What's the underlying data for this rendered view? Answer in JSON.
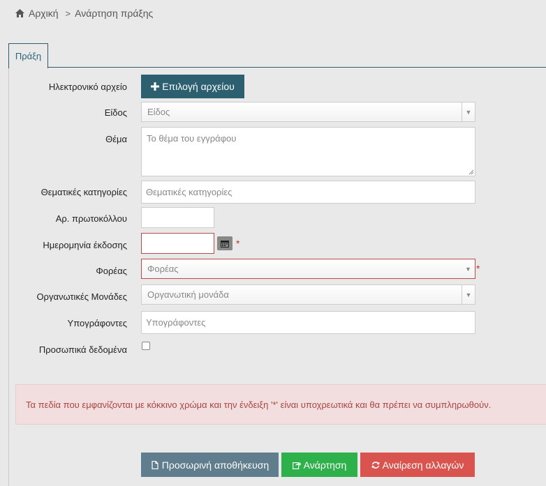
{
  "breadcrumb": {
    "home_icon": "home-icon",
    "home": "Αρχική",
    "separator": ">",
    "current": "Ανάρτηση πράξης"
  },
  "tab": {
    "label": "Πράξη"
  },
  "form": {
    "electronic_file": {
      "label": "Ηλεκτρονικό αρχείο",
      "button": "Επιλογή αρχείου",
      "icon": "plus-icon"
    },
    "type": {
      "label": "Είδος",
      "placeholder": "Είδος"
    },
    "subject": {
      "label": "Θέμα",
      "placeholder": "Το θέμα του εγγράφου"
    },
    "thematic_categories": {
      "label": "Θεματικές κατηγορίες",
      "placeholder": "Θεματικές κατηγορίες"
    },
    "protocol_number": {
      "label": "Αρ. πρωτοκόλλου",
      "value": ""
    },
    "issue_date": {
      "label": "Ημερομηνία έκδοσης",
      "value": "",
      "icon": "calendar-icon"
    },
    "organization": {
      "label": "Φορέας",
      "placeholder": "Φορέας"
    },
    "org_units": {
      "label": "Οργανωτικές Μονάδες",
      "placeholder": "Οργανωτική μονάδα"
    },
    "signers": {
      "label": "Υπογράφοντες",
      "placeholder": "Υπογράφοντες"
    },
    "personal_data": {
      "label": "Προσωπικά δεδομένα",
      "checked": false
    },
    "required_marker": "*"
  },
  "alert": {
    "text": "Τα πεδία που εμφανίζονται με κόκκινο χρώμα και την ένδειξη '*' είναι υποχρεωτικά και θα πρέπει να συμπληρωθούν."
  },
  "actions": {
    "save": {
      "label": "Προσωρινή αποθήκευση",
      "icon": "file-icon"
    },
    "publish": {
      "label": "Ανάρτηση",
      "icon": "share-icon"
    },
    "reset": {
      "label": "Αναίρεση αλλαγών",
      "icon": "refresh-icon"
    }
  },
  "colors": {
    "primary": "#2c5f70",
    "required": "#b94a48",
    "success": "#2eb14b",
    "danger": "#d9534f",
    "save": "#5f7d8c",
    "alert_bg": "#f2dede"
  }
}
